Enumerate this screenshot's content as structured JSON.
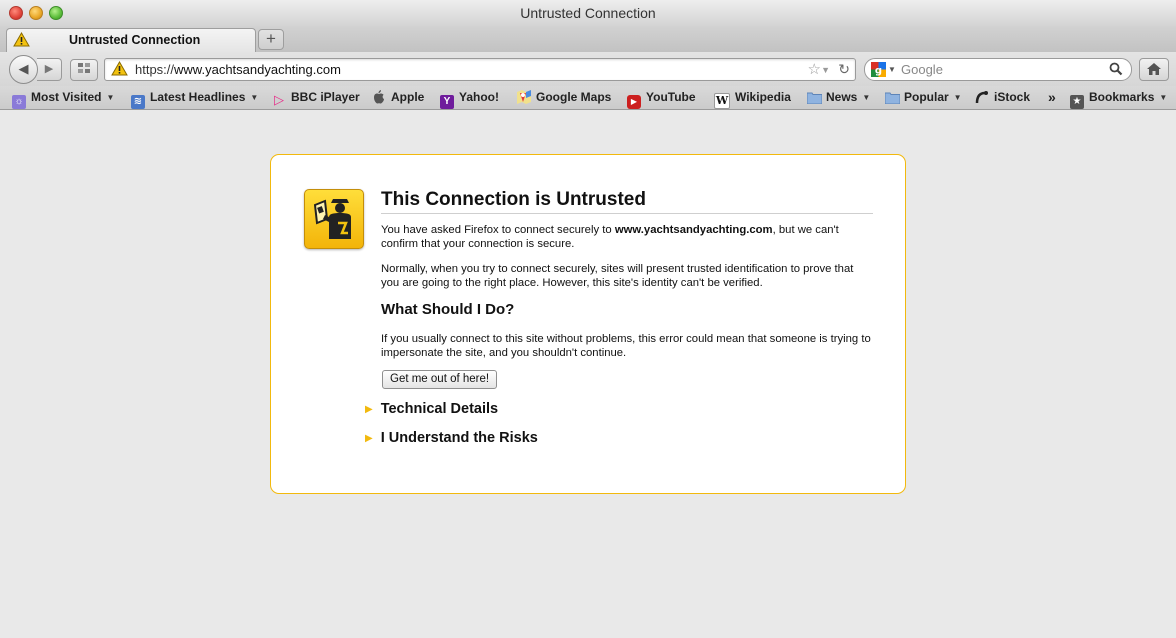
{
  "window": {
    "title": "Untrusted Connection"
  },
  "tabs": [
    {
      "title": "Untrusted Connection"
    }
  ],
  "newtab_label": "+",
  "navigation": {
    "url_scheme": "https://",
    "url_host": "www.yachtsandyachting.com",
    "search_engine": "google-icon",
    "search_placeholder": "Google"
  },
  "bookmarks": {
    "items": [
      {
        "label": "Most Visited",
        "icon": "most-visited-icon",
        "has_dropdown": true
      },
      {
        "label": "Latest Headlines",
        "icon": "rss-icon",
        "has_dropdown": true
      },
      {
        "label": "BBC iPlayer",
        "icon": "bbc-iplayer-icon",
        "has_dropdown": false
      },
      {
        "label": "Apple",
        "icon": "apple-icon",
        "has_dropdown": false
      },
      {
        "label": "Yahoo!",
        "icon": "yahoo-icon",
        "has_dropdown": false
      },
      {
        "label": "Google Maps",
        "icon": "google-maps-icon",
        "has_dropdown": false
      },
      {
        "label": "YouTube",
        "icon": "youtube-icon",
        "has_dropdown": false
      },
      {
        "label": "Wikipedia",
        "icon": "wikipedia-icon",
        "has_dropdown": false
      },
      {
        "label": "News",
        "icon": "folder-icon",
        "has_dropdown": true
      },
      {
        "label": "Popular",
        "icon": "folder-icon",
        "has_dropdown": true
      },
      {
        "label": "iStock",
        "icon": "istock-icon",
        "has_dropdown": false
      }
    ],
    "overflow_label": "»",
    "bookmarks_menu_label": "Bookmarks"
  },
  "error_page": {
    "title": "This Connection is Untrusted",
    "intro_prefix": "You have asked Firefox to connect securely to ",
    "intro_host": "www.yachtsandyachting.com",
    "intro_suffix": ", but we can't confirm that your connection is secure.",
    "para2": "Normally, when you try to connect securely, sites will present trusted identification to prove that you are going to the right place. However, this site's identity can't be verified.",
    "what_title": "What Should I Do?",
    "para3": "If you usually connect to this site without problems, this error could mean that someone is trying to impersonate the site, and you shouldn't continue.",
    "escape_button": "Get me out of here!",
    "technical_details": "Technical Details",
    "understand_risks": "I Understand the Risks"
  },
  "colors": {
    "accent_border": "#f2b90d",
    "icon_yellow": "#f3b409",
    "page_background": "#e9e9e9"
  }
}
